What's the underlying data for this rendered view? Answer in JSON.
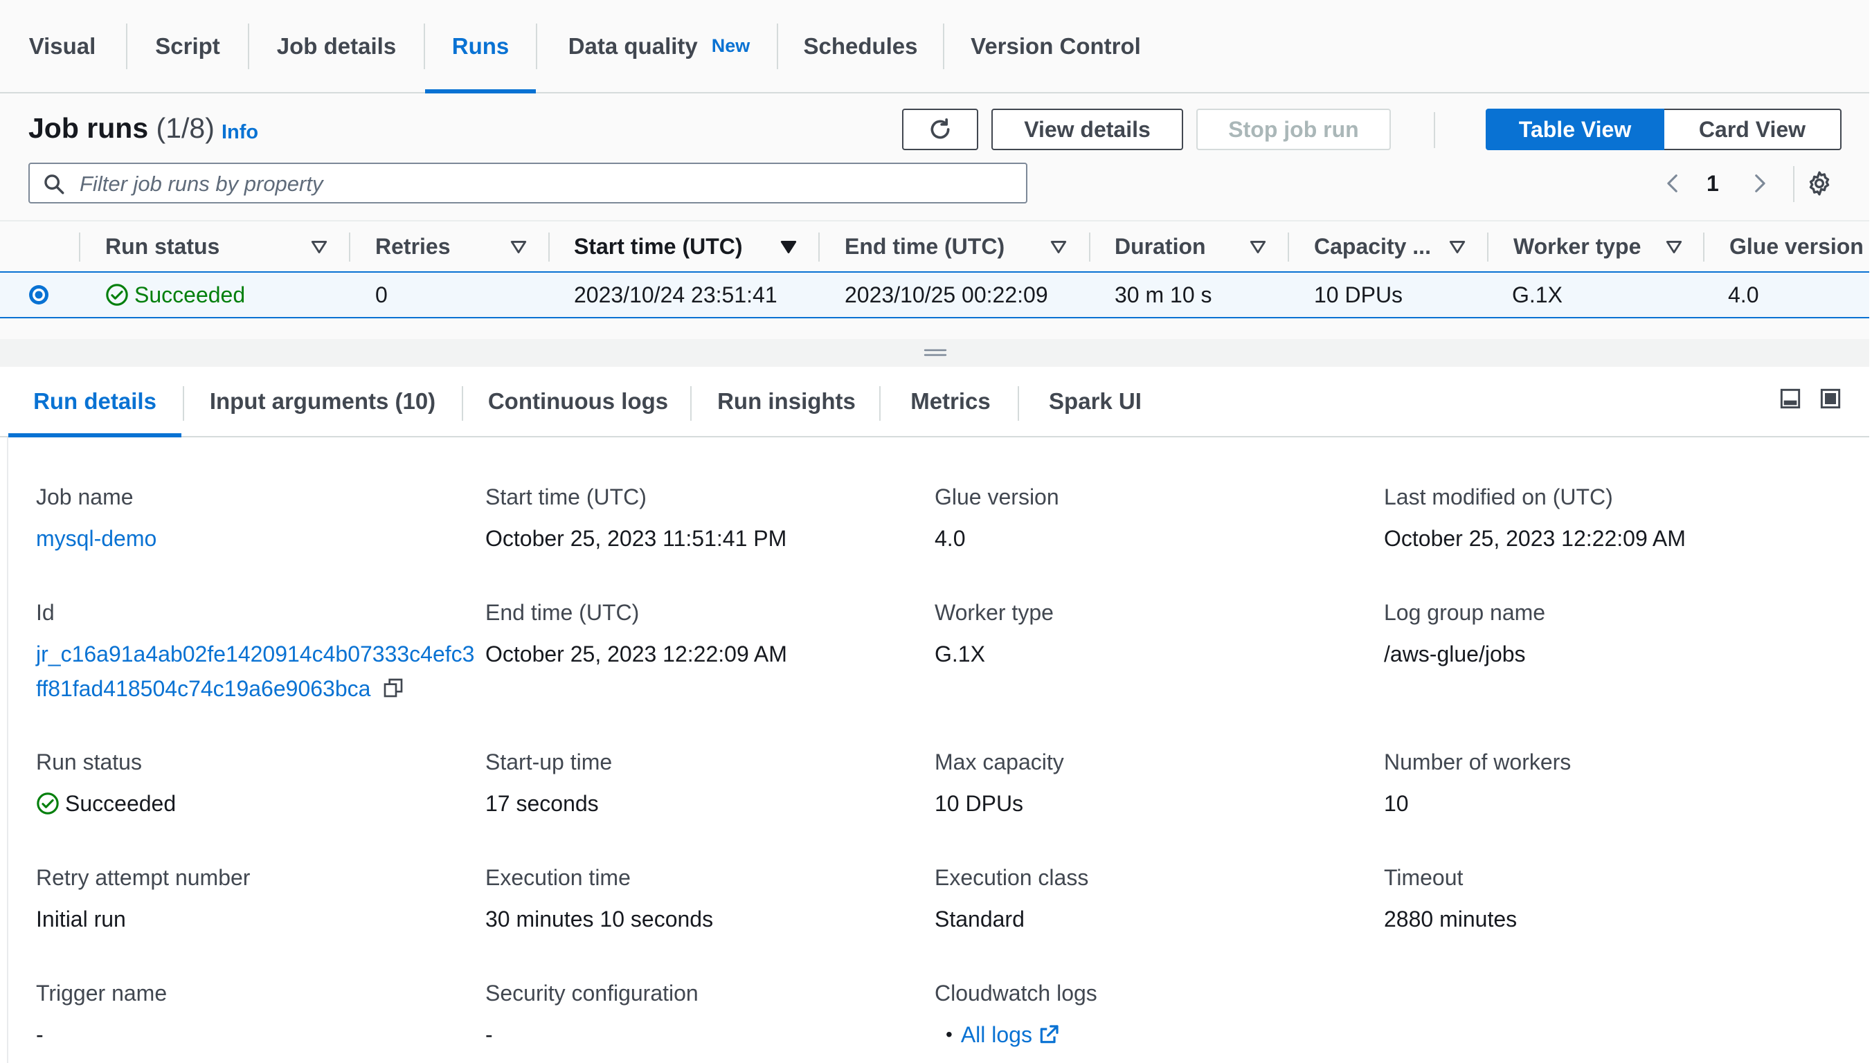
{
  "top_tabs": [
    {
      "label": "Visual"
    },
    {
      "label": "Script"
    },
    {
      "label": "Job details"
    },
    {
      "label": "Runs"
    },
    {
      "label": "Data quality",
      "badge": "New"
    },
    {
      "label": "Schedules"
    },
    {
      "label": "Version Control"
    }
  ],
  "active_top_tab": "Runs",
  "job_runs": {
    "title": "Job runs",
    "count": "(1/8)",
    "info_label": "Info",
    "refresh_icon": "refresh-icon",
    "view_details_label": "View details",
    "stop_job_run_label": "Stop job run",
    "table_view_label": "Table View",
    "card_view_label": "Card View",
    "search_placeholder": "Filter job runs by property",
    "page_number": "1"
  },
  "table": {
    "columns": [
      "Run status",
      "Retries",
      "Start time (UTC)",
      "End time (UTC)",
      "Duration",
      "Capacity ...",
      "Worker type",
      "Glue version"
    ],
    "sorted_column": "Start time (UTC)",
    "rows": [
      {
        "selected": true,
        "run_status": "Succeeded",
        "retries": "0",
        "start_time": "2023/10/24 23:51:41",
        "end_time": "2023/10/25 00:22:09",
        "duration": "30 m 10 s",
        "capacity": "10 DPUs",
        "worker_type": "G.1X",
        "glue_version": "4.0"
      }
    ]
  },
  "detail_tabs": [
    {
      "label": "Run details"
    },
    {
      "label": "Input arguments (10)"
    },
    {
      "label": "Continuous logs"
    },
    {
      "label": "Run insights"
    },
    {
      "label": "Metrics"
    },
    {
      "label": "Spark UI"
    }
  ],
  "active_detail_tab": "Run details",
  "details": {
    "job_name": {
      "label": "Job name",
      "value": "mysql-demo"
    },
    "start_time": {
      "label": "Start time (UTC)",
      "value": "October 25, 2023 11:51:41 PM"
    },
    "glue_version": {
      "label": "Glue version",
      "value": "4.0"
    },
    "last_modified": {
      "label": "Last modified on (UTC)",
      "value": "October 25, 2023 12:22:09 AM"
    },
    "id": {
      "label": "Id",
      "value_line1": "jr_c16a91a4ab02fe1420914c4b07333c4efc3",
      "value_line2": "ff81fad418504c74c19a6e9063bca"
    },
    "end_time": {
      "label": "End time (UTC)",
      "value": "October 25, 2023 12:22:09 AM"
    },
    "worker_type": {
      "label": "Worker type",
      "value": "G.1X"
    },
    "log_group": {
      "label": "Log group name",
      "value": "/aws-glue/jobs"
    },
    "run_status": {
      "label": "Run status",
      "value": "Succeeded"
    },
    "startup_time": {
      "label": "Start-up time",
      "value": "17 seconds"
    },
    "max_capacity": {
      "label": "Max capacity",
      "value": "10 DPUs"
    },
    "num_workers": {
      "label": "Number of workers",
      "value": "10"
    },
    "retry_attempt": {
      "label": "Retry attempt number",
      "value": "Initial run"
    },
    "execution_time": {
      "label": "Execution time",
      "value": "30 minutes 10 seconds"
    },
    "execution_class": {
      "label": "Execution class",
      "value": "Standard"
    },
    "timeout": {
      "label": "Timeout",
      "value": "2880 minutes"
    },
    "trigger_name": {
      "label": "Trigger name",
      "value": "-"
    },
    "security_config": {
      "label": "Security configuration",
      "value": "-"
    },
    "cloudwatch_logs": {
      "label": "Cloudwatch logs",
      "link_label": "All logs"
    }
  },
  "colors": {
    "accent": "#0972d3",
    "success": "#037f0c",
    "text": "#16191f",
    "muted": "#414750"
  }
}
